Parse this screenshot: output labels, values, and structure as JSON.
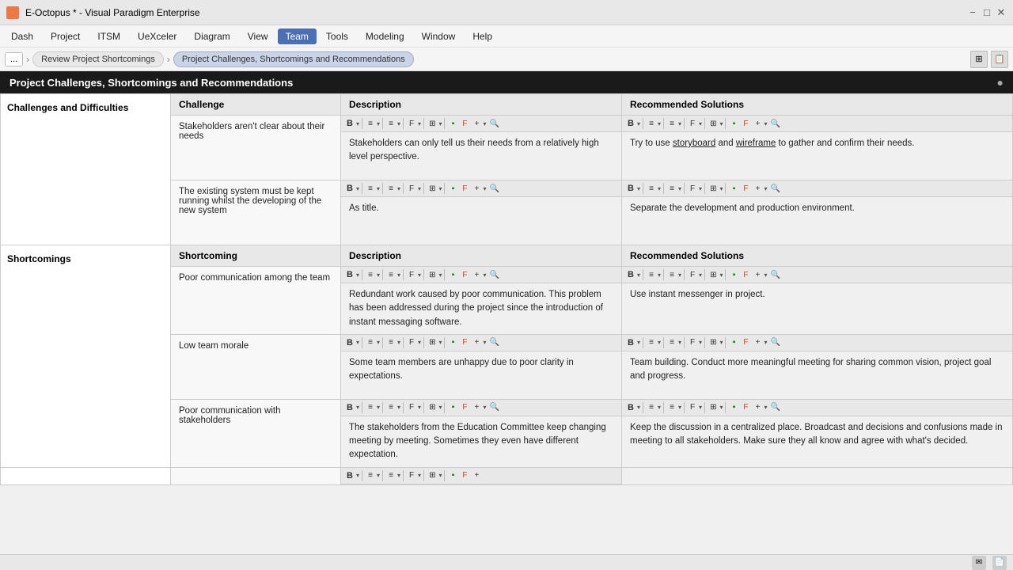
{
  "titleBar": {
    "appName": "E-Octopus * - Visual Paradigm Enterprise",
    "iconColor": "#cc4422"
  },
  "menuBar": {
    "items": [
      "Dash",
      "Project",
      "ITSM",
      "UeXceler",
      "Diagram",
      "View",
      "Team",
      "Tools",
      "Modeling",
      "Window",
      "Help"
    ],
    "activeItem": "Team"
  },
  "breadcrumb": {
    "dots": "...",
    "items": [
      "Review Project Shortcomings",
      "Project Challenges, Shortcomings and Recommendations"
    ],
    "activeIndex": 1
  },
  "sectionHeader": {
    "title": "Project Challenges, Shortcomings and Recommendations"
  },
  "challengesSection": {
    "sectionLabel": "Challenges and Difficulties",
    "columns": [
      "Challenge",
      "Description",
      "Recommended Solutions"
    ],
    "rows": [
      {
        "challenge": "Stakeholders aren't clear about their needs",
        "description": "Stakeholders can only tell us their needs from a relatively high level perspective.",
        "descriptionHtml": "Stakeholders can only tell us their needs from a relatively high level perspective.",
        "recommendation": "Try to use <u>storyboard</u> and <u>wireframe</u> to gather and confirm their needs.",
        "recommendationHtml": "Try to use storyboard and wireframe to gather and confirm their needs."
      },
      {
        "challenge": "The existing system must be kept running whilst the developing of the new system",
        "description": "As title.",
        "recommendation": "Separate the development and production environment."
      }
    ]
  },
  "shortcomingsSection": {
    "sectionLabel": "Shortcomings",
    "columns": [
      "Shortcoming",
      "Description",
      "Recommended Solutions"
    ],
    "rows": [
      {
        "challenge": "Poor communication among the team",
        "description": "Redundant work caused by poor communication. This problem has been addressed during the project since the introduction of instant messaging software.",
        "recommendation": "Use instant messenger in project."
      },
      {
        "challenge": "Low team morale",
        "description": "Some team members are unhappy due to poor clarity in expectations.",
        "recommendation": "Team building. Conduct more meaningful meeting for sharing common vision, project goal and progress."
      },
      {
        "challenge": "Poor communication with stakeholders",
        "description": "The stakeholders from the Education Committee keep changing meeting by meeting. Sometimes they even have different expectation.",
        "recommendation": "Keep the discussion in a centralized place. Broadcast and decisions and confusions made in meeting to all stakeholders. Make sure they all know and agree with what's decided."
      }
    ]
  },
  "toolbar": {
    "buttons": [
      "B",
      "≡",
      "≡",
      "F",
      "⊞",
      "▪",
      "F",
      "+",
      "🔍"
    ]
  }
}
